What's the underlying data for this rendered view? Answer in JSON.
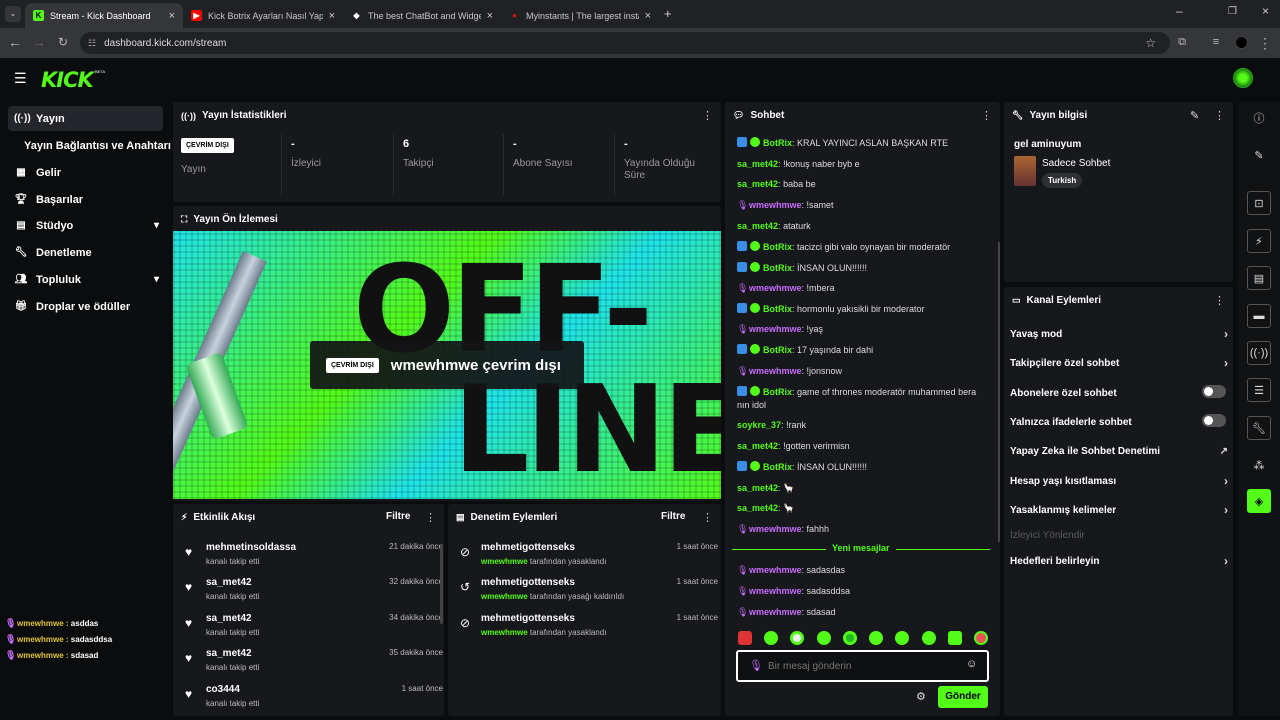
{
  "browser": {
    "tabs": [
      {
        "title": "Stream - Kick Dashboard",
        "fav": "K",
        "favColor": "#53fc18"
      },
      {
        "title": "Kick Botrix Ayarları Nasıl Yapılır",
        "fav": "▶",
        "favColor": "#ff0000"
      },
      {
        "title": "The best ChatBot and Widgets",
        "fav": "◆",
        "favColor": "#ffffff"
      },
      {
        "title": "Myinstants | The largest instant",
        "fav": "●",
        "favColor": "#d11"
      }
    ],
    "url": "dashboard.kick.com/stream"
  },
  "header": {
    "logo": "KICK",
    "beta": "BETA"
  },
  "sidebar": {
    "items": [
      {
        "label": "Yayın",
        "icon": "broadcast-icon"
      },
      {
        "label": "Yayın Bağlantısı ve Anahtarı",
        "icon": ""
      },
      {
        "label": "Gelir",
        "icon": "chart-icon"
      },
      {
        "label": "Başarılar",
        "icon": "trophy-icon"
      },
      {
        "label": "Stüdyo",
        "icon": "studio-icon"
      },
      {
        "label": "Denetleme",
        "icon": "wrench-icon"
      },
      {
        "label": "Topluluk",
        "icon": "community-icon"
      },
      {
        "label": "Droplar ve ödüller",
        "icon": "gift-icon"
      }
    ]
  },
  "overlay_chat": [
    {
      "user": "wmewhmwe",
      "text": "asddas"
    },
    {
      "user": "wmewhmwe",
      "text": "sadasddsa"
    },
    {
      "user": "wmewhmwe",
      "text": "sdasad"
    }
  ],
  "stats": {
    "title": "Yayın İstatistikleri",
    "status_badge": "ÇEVRİM DIŞI",
    "items": [
      {
        "value": "",
        "label": "Yayın"
      },
      {
        "value": "-",
        "label": "İzleyici"
      },
      {
        "value": "6",
        "label": "Takipçi"
      },
      {
        "value": "-",
        "label": "Abone Sayısı"
      },
      {
        "value": "-",
        "label": "Yayında Olduğu Süre"
      }
    ]
  },
  "preview": {
    "title": "Yayın Ön İzlemesi",
    "badge": "ÇEVRİM DIŞI",
    "text": "wmewhmwe çevrim dışı",
    "big_top": "OFF-",
    "big_bottom": "LINE"
  },
  "activity": {
    "title": "Etkinlik Akışı",
    "filter": "Filtre",
    "items": [
      {
        "user": "mehmetinsoldassa",
        "desc": "kanalı takip etti",
        "time": "21 dakika önce"
      },
      {
        "user": "sa_met42",
        "desc": "kanalı takip etti",
        "time": "32 dakika önce"
      },
      {
        "user": "sa_met42",
        "desc": "kanalı takip etti",
        "time": "34 dakika önce"
      },
      {
        "user": "sa_met42",
        "desc": "kanalı takip etti",
        "time": "35 dakika önce"
      },
      {
        "user": "co3444",
        "desc": "kanalı takip etti",
        "time": "1 saat önce"
      }
    ]
  },
  "moderation": {
    "title": "Denetim Eylemleri",
    "filter": "Filtre",
    "items": [
      {
        "user": "mehmetigottenseks",
        "by": "wmewhmwe",
        "desc": "tarafından yasaklandı",
        "time": "1 saat önce",
        "icon": "ban-icon"
      },
      {
        "user": "mehmetigottenseks",
        "by": "wmewhmwe",
        "desc": "tarafından yasağı kaldırıldı",
        "time": "1 saat önce",
        "icon": "undo-icon"
      },
      {
        "user": "mehmetigottenseks",
        "by": "wmewhmwe",
        "desc": "tarafından yasaklandı",
        "time": "1 saat önce",
        "icon": "ban-icon"
      }
    ]
  },
  "chat": {
    "title": "Sohbet",
    "new_messages": "Yeni mesajlar",
    "placeholder": "Bir mesaj gönderin",
    "send": "Gönder",
    "messages": [
      {
        "user": "BotRix",
        "type": "bot",
        "text": "KRAL YAYINCI ASLAN BAŞKAN RTE"
      },
      {
        "user": "sa_met42",
        "type": "g",
        "text": "!konuş naber byb e"
      },
      {
        "user": "sa_met42",
        "type": "g",
        "text": "baba be"
      },
      {
        "user": "wmewhmwe",
        "type": "p",
        "text": "!samet"
      },
      {
        "user": "sa_met42",
        "type": "g",
        "text": "ataturk"
      },
      {
        "user": "BotRix",
        "type": "bot",
        "text": "tacizci gibi valo oynayan bir moderatör"
      },
      {
        "user": "BotRix",
        "type": "bot",
        "text": "İNSAN OLUN!!!!!!"
      },
      {
        "user": "wmewhmwe",
        "type": "p",
        "text": "!mbera"
      },
      {
        "user": "BotRix",
        "type": "bot",
        "text": "hormonlu yakısikli bir moderator"
      },
      {
        "user": "wmewhmwe",
        "type": "p",
        "text": "!yaş"
      },
      {
        "user": "BotRix",
        "type": "bot",
        "text": "17 yaşında bir dahi"
      },
      {
        "user": "wmewhmwe",
        "type": "p",
        "text": "!jonsnow"
      },
      {
        "user": "BotRix",
        "type": "bot",
        "text": "game of thrones moderatör muhammed bera nın idol"
      },
      {
        "user": "soykre_37",
        "type": "g",
        "text": "!rank"
      },
      {
        "user": "sa_met42",
        "type": "g",
        "text": "!gotten verirmisn"
      },
      {
        "user": "BotRix",
        "type": "bot",
        "text": "İNSAN OLUN!!!!!!"
      },
      {
        "user": "sa_met42",
        "type": "g",
        "text": "🦙"
      },
      {
        "user": "sa_met42",
        "type": "g",
        "text": "🦙"
      },
      {
        "user": "wmewhmwe",
        "type": "p",
        "text": "fahhh"
      }
    ],
    "new": [
      {
        "user": "wmewhmwe",
        "type": "p",
        "text": "sadasdas"
      },
      {
        "user": "wmewhmwe",
        "type": "p",
        "text": "sadasddsa"
      },
      {
        "user": "wmewhmwe",
        "type": "p",
        "text": "sdasad"
      }
    ]
  },
  "stream_info": {
    "title": "Yayın bilgisi",
    "stream_title": "gel aminuyum",
    "category": "Sadece Sohbet",
    "tag": "Turkish"
  },
  "channel_actions": {
    "title": "Kanal Eylemleri",
    "items": [
      {
        "label": "Yavaş mod",
        "ctrl": "arrow"
      },
      {
        "label": "Takipçilere özel sohbet",
        "ctrl": "arrow"
      },
      {
        "label": "Abonelere özel sohbet",
        "ctrl": "toggle"
      },
      {
        "label": "Yalnızca ifadelerle sohbet",
        "ctrl": "toggle"
      },
      {
        "label": "Yapay Zeka ile Sohbet Denetimi",
        "ctrl": "ext"
      },
      {
        "label": "Hesap yaşı kısıtlaması",
        "ctrl": "arrow"
      },
      {
        "label": "Yasaklanmış kelimeler",
        "ctrl": "arrow"
      },
      {
        "label": "İzleyici Yönlendir",
        "ctrl": "disabled"
      },
      {
        "label": "Hedefleri belirleyin",
        "ctrl": "arrow"
      }
    ]
  }
}
